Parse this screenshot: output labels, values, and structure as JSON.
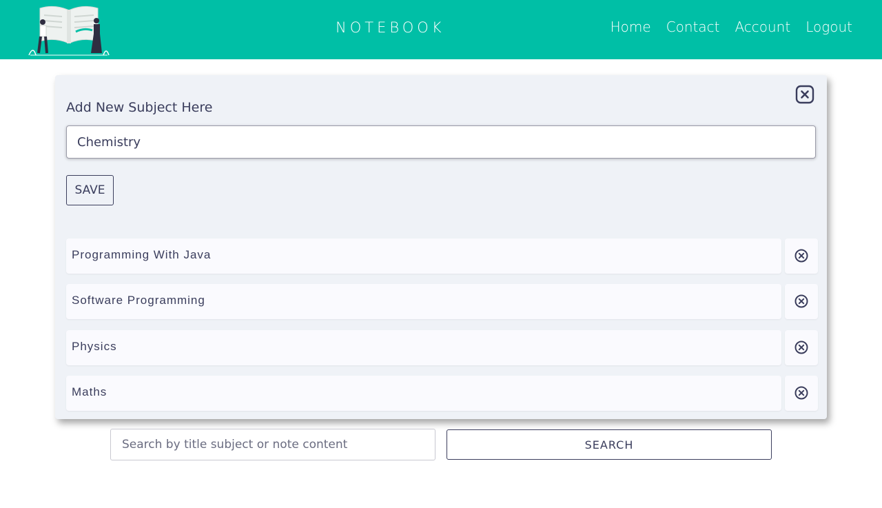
{
  "header": {
    "brand": "NOTEBOOK",
    "logo_icon": "book-illustration-icon",
    "nav": [
      {
        "label": "Home"
      },
      {
        "label": "Contact"
      },
      {
        "label": "Account"
      },
      {
        "label": "Logout"
      }
    ]
  },
  "panel": {
    "title": "Add New Subject Here",
    "input_value": "Chemistry",
    "save_label": "SAVE",
    "close_icon": "close-square-icon",
    "subjects": [
      {
        "label": "Programming With Java"
      },
      {
        "label": "Software Programming"
      },
      {
        "label": "Physics"
      },
      {
        "label": "Maths"
      }
    ],
    "delete_icon": "circle-x-icon"
  },
  "search": {
    "placeholder": "Search by title subject or note content",
    "button_label": "SEARCH"
  },
  "colors": {
    "accent": "#00bfa6",
    "text": "#3a3d5c",
    "panel_bg": "#eff2f7"
  }
}
